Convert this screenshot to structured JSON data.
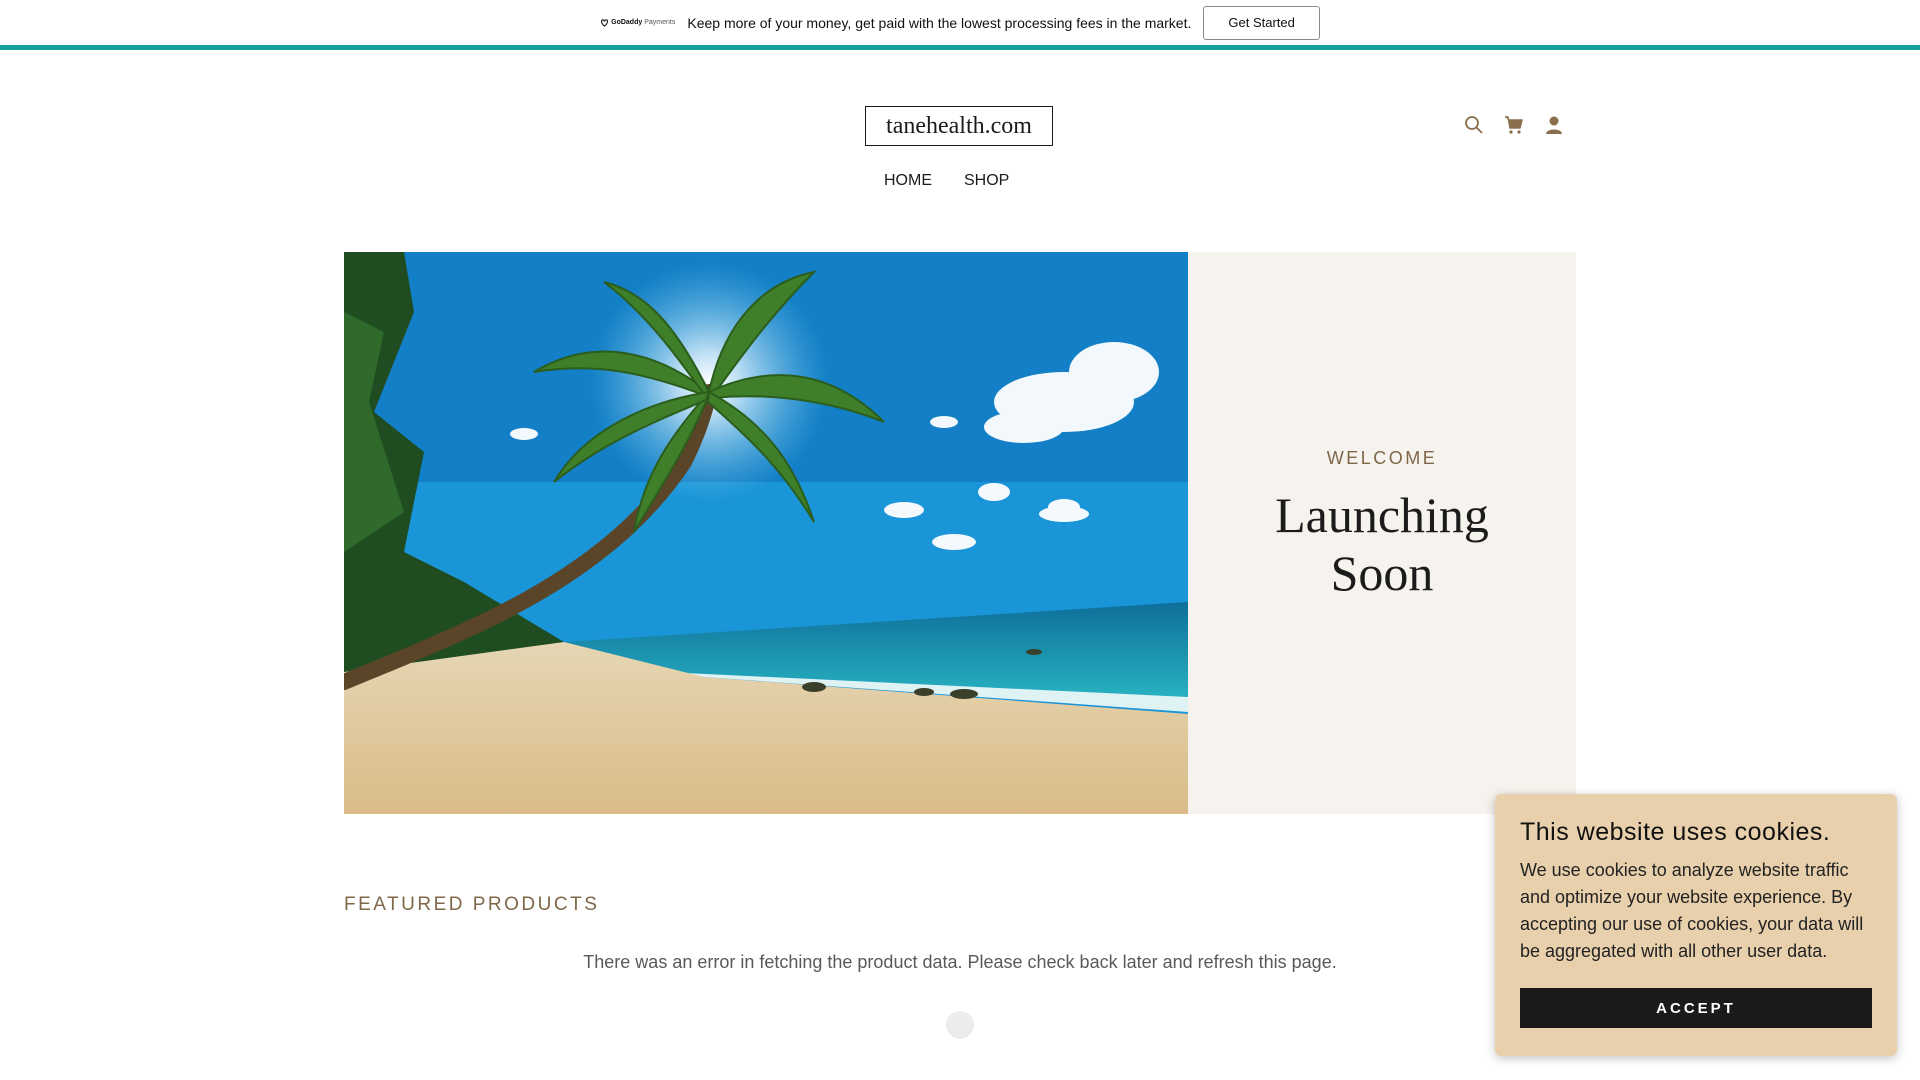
{
  "promo": {
    "brand": "GoDaddy",
    "brand_sub": "Payments",
    "message": "Keep more of your money, get paid with the lowest processing fees in the market.",
    "cta_label": "Get Started",
    "accent_color": "#14a09a"
  },
  "header": {
    "logo_text": "tanehealth.com",
    "icons": [
      "search-icon",
      "cart-icon",
      "account-icon"
    ]
  },
  "nav": {
    "items": [
      {
        "label": "HOME",
        "active": true
      },
      {
        "label": "SHOP",
        "active": false
      }
    ]
  },
  "hero": {
    "eyebrow": "WELCOME",
    "headline_line1": "Launching",
    "headline_line2": "Soon",
    "image_description": "tropical-beach-palm-tree"
  },
  "featured": {
    "title": "FEATURED PRODUCTS",
    "error_message": "There was an error in fetching the product data. Please check back later and refresh this page."
  },
  "cookie": {
    "title": "This website uses cookies.",
    "body": "We use cookies to analyze website traffic and optimize your website experience. By accepting our use of cookies, your data will be aggregated with all other user data.",
    "accept_label": "ACCEPT",
    "background": "#e8d0ac"
  }
}
